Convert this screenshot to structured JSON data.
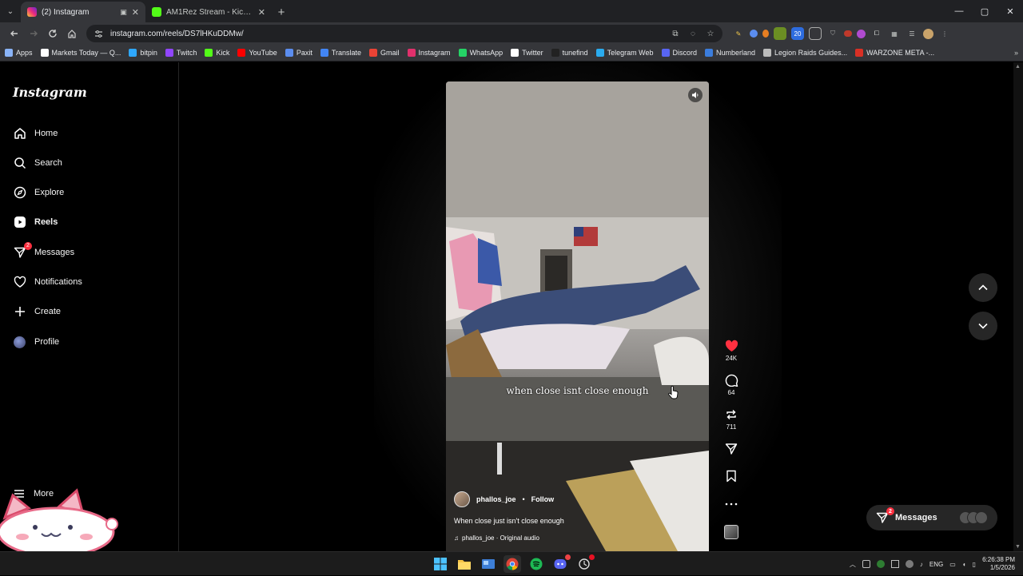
{
  "browser": {
    "tabs": [
      {
        "title": "(2) Instagram",
        "active": true,
        "favicon_color": "#e1306c"
      },
      {
        "title": "AM1Rez Stream - Kick Dashboard",
        "active": false,
        "favicon_color": "#53fc18"
      }
    ],
    "url": "instagram.com/reels/DS7lHKuDDMw/",
    "bookmarks": [
      {
        "label": "Apps",
        "icon": "apps-grid-icon",
        "color": "#8ab4f8"
      },
      {
        "label": "Markets Today — Q...",
        "icon": "markets-icon",
        "color": "#ffffff"
      },
      {
        "label": "bitpin",
        "icon": "bitpin-icon",
        "color": "#2ea8ff"
      },
      {
        "label": "Twitch",
        "icon": "twitch-icon",
        "color": "#9146ff"
      },
      {
        "label": "Kick",
        "icon": "kick-icon",
        "color": "#53fc18"
      },
      {
        "label": "YouTube",
        "icon": "youtube-icon",
        "color": "#ff0000"
      },
      {
        "label": "Paxit",
        "icon": "paxit-icon",
        "color": "#5b8def"
      },
      {
        "label": "Translate",
        "icon": "translate-icon",
        "color": "#4285f4"
      },
      {
        "label": "Gmail",
        "icon": "gmail-icon",
        "color": "#ea4335"
      },
      {
        "label": "Instagram",
        "icon": "instagram-icon",
        "color": "#e1306c"
      },
      {
        "label": "WhatsApp",
        "icon": "whatsapp-icon",
        "color": "#25d366"
      },
      {
        "label": "Twitter",
        "icon": "x-icon",
        "color": "#ffffff"
      },
      {
        "label": "tunefind",
        "icon": "tunefind-icon",
        "color": "#222222"
      },
      {
        "label": "Telegram Web",
        "icon": "telegram-icon",
        "color": "#2aabee"
      },
      {
        "label": "Discord",
        "icon": "discord-icon",
        "color": "#5865f2"
      },
      {
        "label": "Numberland",
        "icon": "numberland-icon",
        "color": "#3b7ddd"
      },
      {
        "label": "Legion Raids Guides...",
        "icon": "legion-icon",
        "color": "#bbbbbb"
      },
      {
        "label": "WARZONE META -...",
        "icon": "warzone-icon",
        "color": "#d93025"
      }
    ]
  },
  "sidebar": {
    "logo": "Instagram",
    "items": [
      {
        "label": "Home",
        "icon": "home-icon"
      },
      {
        "label": "Search",
        "icon": "search-icon"
      },
      {
        "label": "Explore",
        "icon": "compass-icon"
      },
      {
        "label": "Reels",
        "icon": "reels-icon",
        "active": true
      },
      {
        "label": "Messages",
        "icon": "messenger-icon",
        "badge": "2"
      },
      {
        "label": "Notifications",
        "icon": "heart-icon"
      },
      {
        "label": "Create",
        "icon": "plus-icon"
      },
      {
        "label": "Profile",
        "icon": "avatar-icon"
      }
    ],
    "more": "More"
  },
  "reel": {
    "overlay_text": "when close isnt close enough",
    "author": "phallos_joe",
    "separator": "•",
    "follow": "Follow",
    "description": "When close just isn't close enough",
    "audio": "phallos_joe · Original audio",
    "likes": "24K",
    "comments": "64",
    "reposts": "711",
    "liked": true
  },
  "messages_pill": {
    "label": "Messages",
    "badge": "2"
  },
  "taskbar": {
    "language": "ENG",
    "time": "6:26:38 PM",
    "date": "1/5/2026"
  },
  "colors": {
    "accent_red": "#ff3040",
    "background": "#000000",
    "chrome_dark": "#202124"
  }
}
